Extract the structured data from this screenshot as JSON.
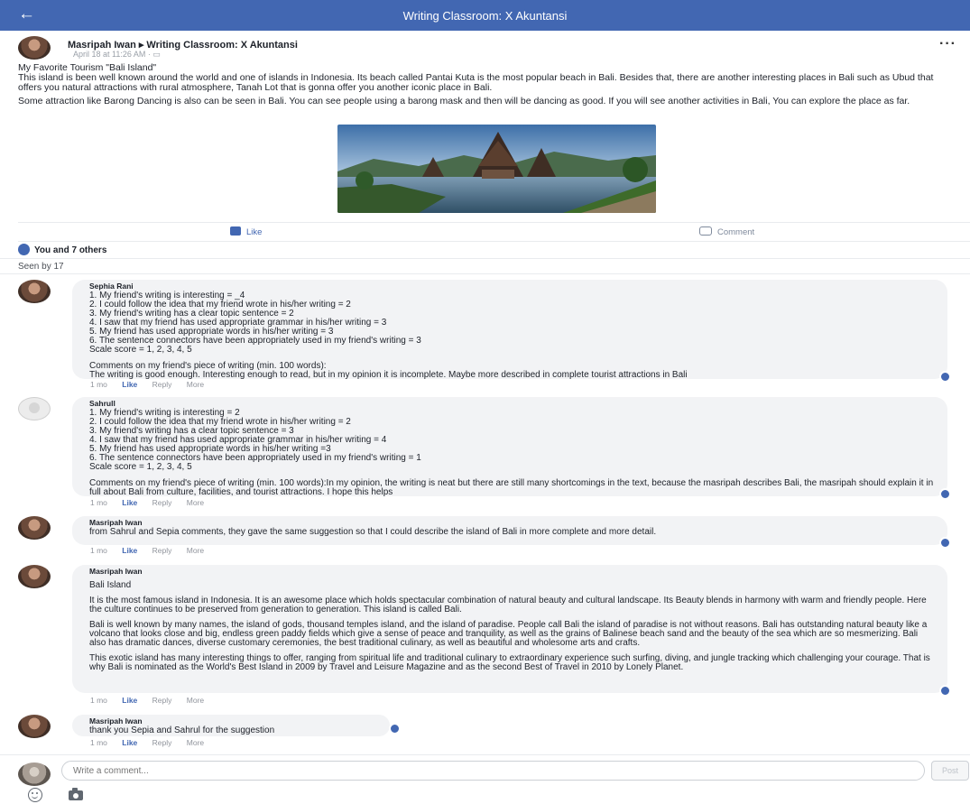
{
  "topbar": {
    "back_icon": "arrow-left-icon",
    "title": "Writing Classroom: X Akuntansi"
  },
  "post": {
    "author": "Masripah Iwan ▸ Writing Classroom: X Akuntansi",
    "meta": "April 18 at 11:26 AM · ",
    "title": "My Favorite Tourism \"Bali Island\"",
    "paragraphs": [
      "This island is been well known around the world and one of islands in Indonesia. Its beach called Pantai Kuta is the most popular beach in Bali. Besides that, there are another interesting places in Bali such as Ubud that offers you natural attractions with rural atmosphere, Tanah Lot that is gonna offer you another iconic place in Bali.",
      "Some attraction like Barong Dancing is also can be seen in Bali. You can see people using a barong mask and then will be dancing as good. If you will see another activities in Bali, You can explore the place as far."
    ],
    "image_subject": "bali-temple-lake-photo",
    "more_icon": "more-horizontal-icon"
  },
  "actions": {
    "like": "Like",
    "comment": "Comment"
  },
  "reactions": "You and 7 others",
  "seen": "Seen by 17",
  "comments": [
    {
      "name": "Sephia Rani",
      "lines": [
        "1. My friend's writing is interesting = _4",
        "2. I could follow the idea that my friend wrote in his/her writing = 2",
        "3. My friend's writing has a clear topic sentence = 2",
        "4. I saw that my friend has used appropriate grammar in his/her writing = 3",
        "5. My friend has used appropriate words in his/her writing = 3",
        "6. The sentence connectors have been appropriately used in my friend's writing = 3",
        "Scale score = 1, 2, 3, 4, 5"
      ],
      "comment_label": "Comments on my friend's piece of writing (min. 100 words):",
      "comment_text": "The writing is good enough. Interesting enough to read, but in my opinion it is incomplete. Maybe more described in complete tourist attractions in Bali",
      "time": "1 mo",
      "like": "Like",
      "reply": "Reply",
      "more": "More"
    },
    {
      "name": "Sahrull",
      "lines": [
        "1. My friend's writing is interesting = 2",
        "2. I could follow the idea that my friend wrote in his/her writing = 2",
        "3. My friend's writing has a clear topic sentence = 3",
        "4. I saw that my friend has used appropriate grammar in his/her writing = 4",
        "5. My friend has used appropriate words in his/her writing =3",
        "6. The sentence connectors have been appropriately used in my friend's writing = 1",
        "Scale score = 1, 2, 3, 4, 5"
      ],
      "comment_text": "Comments on my friend's piece of writing (min. 100 words):In my opinion, the writing is neat but there are still many shortcomings in the text, because the masripah describes Bali, the masripah should explain it in full about Bali from culture, facilities, and tourist attractions. I hope this helps",
      "time": "1 mo",
      "like": "Like",
      "reply": "Reply",
      "more": "More"
    },
    {
      "name": "Masripah Iwan",
      "text": "from Sahrul and Sepia comments, they gave the same suggestion so that I could describe the island of Bali in more complete and more detail.",
      "time": "1 mo",
      "like": "Like",
      "reply": "Reply",
      "more": "More"
    },
    {
      "name": "Masripah Iwan",
      "heading": "Bali Island",
      "paragraphs": [
        "It is the most famous island in Indonesia. It is an awesome place which holds spectacular combination of natural beauty and cultural landscape. Its Beauty blends in harmony with warm and friendly people. Here the culture continues to be preserved from generation to generation. This island is called Bali.",
        "Bali is well known by many names, the island of gods, thousand temples island, and the island of paradise. People call Bali the island of paradise is not without reasons. Bali has outstanding natural beauty like a volcano that looks close and big, endless green paddy fields which give a sense of peace and tranquility, as well as the grains of Balinese beach sand and the beauty of the sea which are so mesmerizing. Bali also has dramatic dances, diverse customary ceremonies, the best traditional culinary, as well as beautiful and wholesome arts and crafts.",
        "This exotic island has many interesting things to offer, ranging from spiritual life and traditional culinary to extraordinary experience such surfing, diving, and jungle tracking which challenging your courage. That is why Bali is nominated as the World's Best Island in 2009 by Travel and Leisure Magazine and as the second Best of Travel in 2010 by Lonely Planet."
      ],
      "time": "1 mo",
      "like": "Like",
      "reply": "Reply",
      "more": "More"
    },
    {
      "name": "Masripah Iwan",
      "text": "thank you Sepia and Sahrul for the suggestion",
      "time": "1 mo",
      "like": "Like",
      "reply": "Reply",
      "more": "More"
    }
  ],
  "composer": {
    "placeholder": "Write a comment...",
    "post": "Post",
    "emoji_icon": "smiley-icon",
    "camera_icon": "camera-icon"
  },
  "colors": {
    "brand": "#4267b2",
    "bubble": "#f2f3f5",
    "meta": "#90949c"
  }
}
